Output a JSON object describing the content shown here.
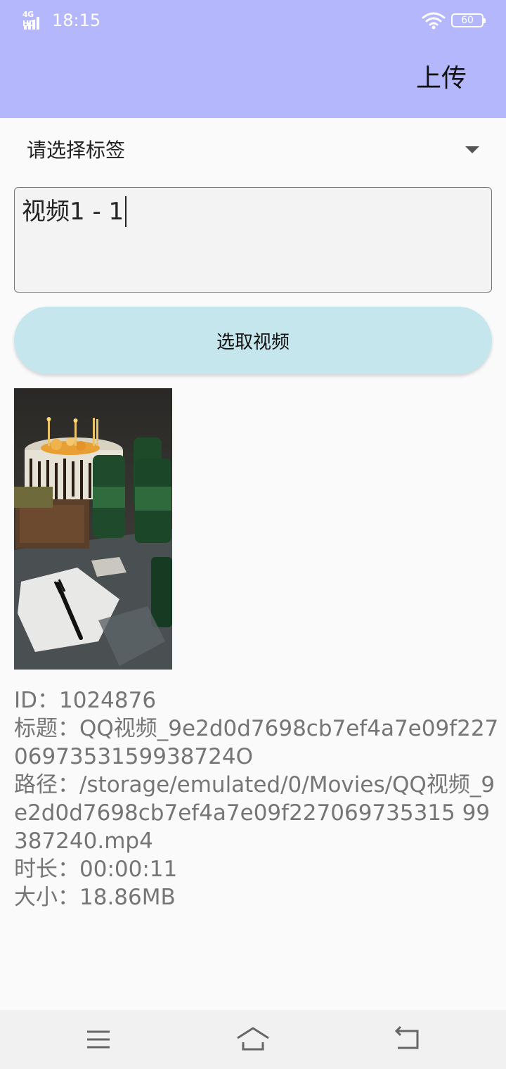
{
  "status_bar": {
    "network": "4G HD",
    "time": "18:15",
    "battery": "60"
  },
  "app_bar": {
    "upload_label": "上传"
  },
  "tag_select": {
    "selected": "请选择标签"
  },
  "title_input": {
    "value": "视频1 - 1"
  },
  "pick_button": {
    "label": "选取视频"
  },
  "video_info": {
    "id_line": "ID：1024876",
    "title_line": "标题：QQ视频_9e2d0d7698cb7ef4a7e09f2270697353159938724O",
    "path_line": "路径：/storage/emulated/0/Movies/QQ视频_9e2d0d7698cb7ef4a7e09f227069735315 99387240.mp4",
    "duration_line": "时长：00:00:11",
    "size_line": "大小：18.86MB"
  },
  "colors": {
    "app_bar": "#b4b7fb",
    "button": "#c6e6ee",
    "info_text": "#757575"
  }
}
